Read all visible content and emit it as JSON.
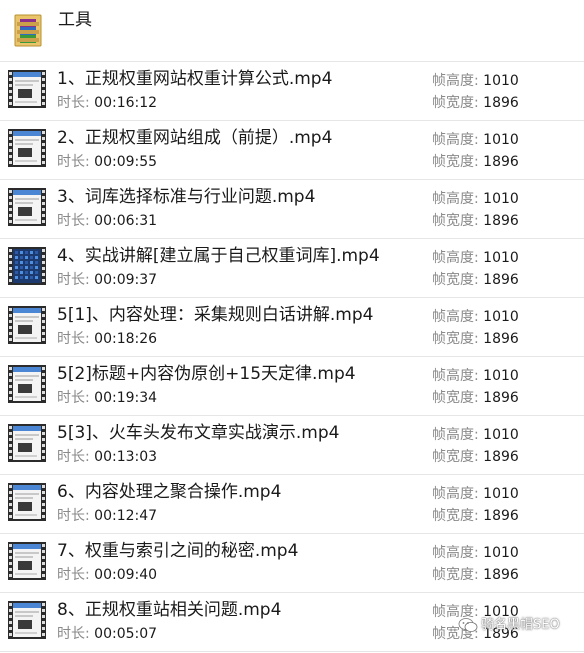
{
  "folder": {
    "title": "工具",
    "icon": "winrar-folder-icon"
  },
  "labels": {
    "duration": "时长:",
    "frame_height": "帧高度:",
    "frame_width": "帧宽度:"
  },
  "files": [
    {
      "name": "1、正规权重网站权重计算公式.mp4",
      "duration": "00:16:12",
      "height": "1010",
      "width": "1896",
      "thumb": "light"
    },
    {
      "name": "2、正规权重网站组成（前提）.mp4",
      "duration": "00:09:55",
      "height": "1010",
      "width": "1896",
      "thumb": "light"
    },
    {
      "name": "3、词库选择标准与行业问题.mp4",
      "duration": "00:06:31",
      "height": "1010",
      "width": "1896",
      "thumb": "light"
    },
    {
      "name": "4、实战讲解[建立属于自己权重词库].mp4",
      "duration": "00:09:37",
      "height": "1010",
      "width": "1896",
      "thumb": "dark"
    },
    {
      "name": "5[1]、内容处理：采集规则白话讲解.mp4",
      "duration": "00:18:26",
      "height": "1010",
      "width": "1896",
      "thumb": "light"
    },
    {
      "name": "5[2]标题+内容伪原创+15天定律.mp4",
      "duration": "00:19:34",
      "height": "1010",
      "width": "1896",
      "thumb": "light"
    },
    {
      "name": "5[3]、火车头发布文章实战演示.mp4",
      "duration": "00:13:03",
      "height": "1010",
      "width": "1896",
      "thumb": "light"
    },
    {
      "name": "6、内容处理之聚合操作.mp4",
      "duration": "00:12:47",
      "height": "1010",
      "width": "1896",
      "thumb": "light"
    },
    {
      "name": "7、权重与索引之间的秘密.mp4",
      "duration": "00:09:40",
      "height": "1010",
      "width": "1896",
      "thumb": "light"
    },
    {
      "name": "8、正规权重站相关问题.mp4",
      "duration": "00:05:07",
      "height": "1010",
      "width": "1896",
      "thumb": "light"
    }
  ],
  "watermark": {
    "text": "骑名黑帽SEO",
    "icon": "wechat-icon"
  },
  "colors": {
    "label_gray": "#8a8a8a",
    "divider": "#e6e6e6",
    "text": "#1a1a1a"
  }
}
